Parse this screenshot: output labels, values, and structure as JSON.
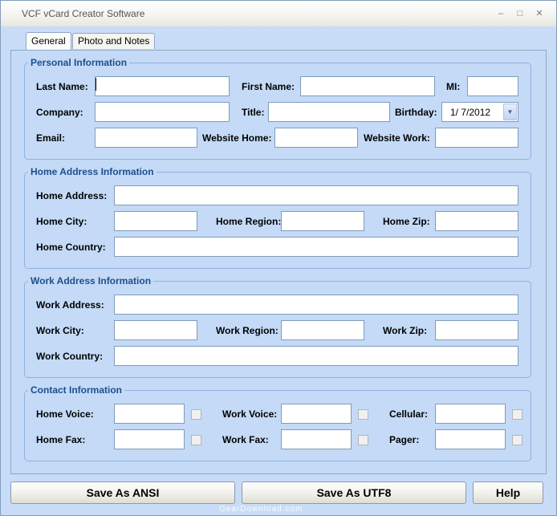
{
  "window": {
    "title": "VCF vCard Creator Software",
    "controls": {
      "minimize": "–",
      "maximize": "□",
      "close": "✕"
    }
  },
  "tabs": [
    {
      "label": "General",
      "active": true
    },
    {
      "label": "Photo and Notes",
      "active": false
    }
  ],
  "personal": {
    "legend": "Personal Information",
    "last_name_label": "Last Name:",
    "last_name_value": "",
    "first_name_label": "First Name:",
    "first_name_value": "",
    "mi_label": "MI:",
    "mi_value": "",
    "company_label": "Company:",
    "company_value": "",
    "title_label": "Title:",
    "title_value": "",
    "birthday_label": "Birthday:",
    "birthday_value": "1/  7/2012",
    "email_label": "Email:",
    "email_value": "",
    "website_home_label": "Website Home:",
    "website_home_value": "",
    "website_work_label": "Website Work:",
    "website_work_value": ""
  },
  "home": {
    "legend": "Home Address Information",
    "address_label": "Home Address:",
    "address_value": "",
    "city_label": "Home City:",
    "city_value": "",
    "region_label": "Home Region:",
    "region_value": "",
    "zip_label": "Home Zip:",
    "zip_value": "",
    "country_label": "Home Country:",
    "country_value": ""
  },
  "work": {
    "legend": "Work Address Information",
    "address_label": "Work Address:",
    "address_value": "",
    "city_label": "Work City:",
    "city_value": "",
    "region_label": "Work Region:",
    "region_value": "",
    "zip_label": "Work Zip:",
    "zip_value": "",
    "country_label": "Work Country:",
    "country_value": ""
  },
  "contact": {
    "legend": "Contact Information",
    "home_voice_label": "Home Voice:",
    "home_voice_value": "",
    "work_voice_label": "Work Voice:",
    "work_voice_value": "",
    "cellular_label": "Cellular:",
    "cellular_value": "",
    "home_fax_label": "Home Fax:",
    "home_fax_value": "",
    "work_fax_label": "Work Fax:",
    "work_fax_value": "",
    "pager_label": "Pager:",
    "pager_value": ""
  },
  "buttons": {
    "save_ansi": "Save As ANSI",
    "save_utf8": "Save As UTF8",
    "help": "Help"
  },
  "watermark": "GearDownload.com",
  "icons": {
    "dropdown": "chevron-down-icon"
  },
  "colors": {
    "window_bg": "#c9dcf7",
    "legend_text": "#1d4f8c",
    "group_border": "#8fb2dd"
  }
}
